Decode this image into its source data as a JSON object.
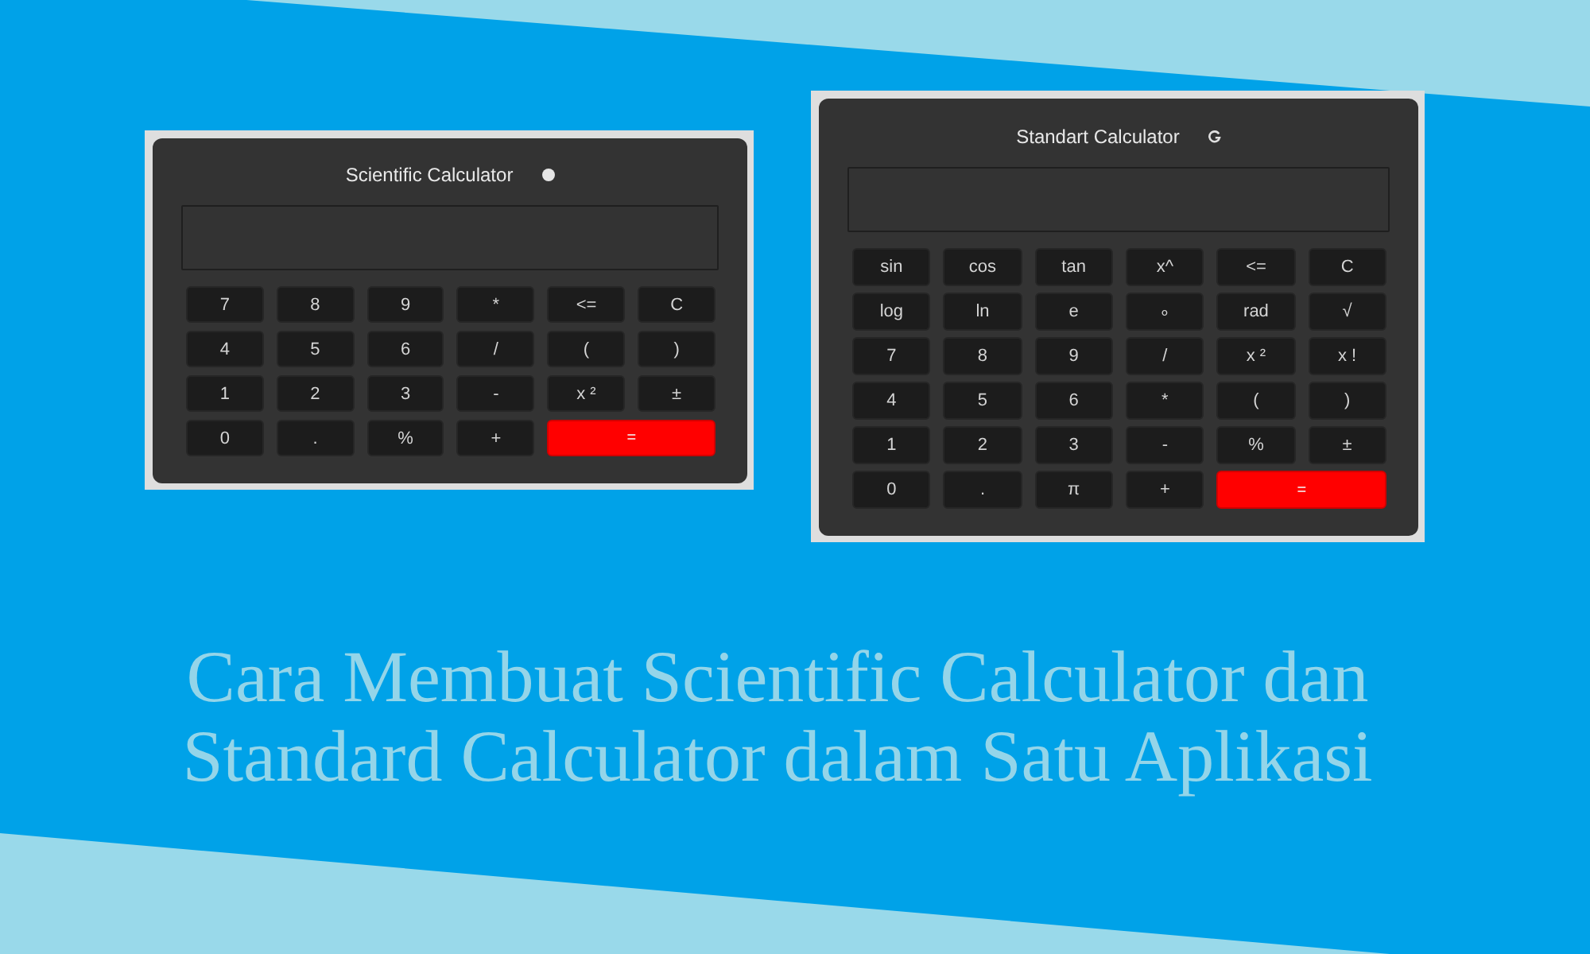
{
  "calculators": [
    {
      "title": "Scientific Calculator",
      "keys": [
        {
          "label": "7",
          "kind": "key"
        },
        {
          "label": "8",
          "kind": "key"
        },
        {
          "label": "9",
          "kind": "key"
        },
        {
          "label": "*",
          "kind": "key"
        },
        {
          "label": "<=",
          "kind": "key"
        },
        {
          "label": "C",
          "kind": "key"
        },
        {
          "label": "4",
          "kind": "key"
        },
        {
          "label": "5",
          "kind": "key"
        },
        {
          "label": "6",
          "kind": "key"
        },
        {
          "label": "/",
          "kind": "key"
        },
        {
          "label": "(",
          "kind": "key"
        },
        {
          "label": ")",
          "kind": "key"
        },
        {
          "label": "1",
          "kind": "key"
        },
        {
          "label": "2",
          "kind": "key"
        },
        {
          "label": "3",
          "kind": "key"
        },
        {
          "label": "-",
          "kind": "key"
        },
        {
          "label": "x ²",
          "kind": "key"
        },
        {
          "label": "±",
          "kind": "key"
        },
        {
          "label": "0",
          "kind": "key"
        },
        {
          "label": ".",
          "kind": "key"
        },
        {
          "label": "%",
          "kind": "key"
        },
        {
          "label": "+",
          "kind": "key"
        },
        {
          "label": "=",
          "kind": "equals"
        }
      ]
    },
    {
      "title": "Standart Calculator",
      "keys": [
        {
          "label": "sin",
          "kind": "key"
        },
        {
          "label": "cos",
          "kind": "key"
        },
        {
          "label": "tan",
          "kind": "key"
        },
        {
          "label": "x^",
          "kind": "key"
        },
        {
          "label": "<=",
          "kind": "key"
        },
        {
          "label": "C",
          "kind": "key"
        },
        {
          "label": "log",
          "kind": "key"
        },
        {
          "label": "ln",
          "kind": "key"
        },
        {
          "label": "e",
          "kind": "key"
        },
        {
          "label": "∘",
          "kind": "key"
        },
        {
          "label": "rad",
          "kind": "key"
        },
        {
          "label": "√",
          "kind": "key"
        },
        {
          "label": "7",
          "kind": "key"
        },
        {
          "label": "8",
          "kind": "key"
        },
        {
          "label": "9",
          "kind": "key"
        },
        {
          "label": "/",
          "kind": "key"
        },
        {
          "label": "x ²",
          "kind": "key"
        },
        {
          "label": "x !",
          "kind": "key"
        },
        {
          "label": "4",
          "kind": "key"
        },
        {
          "label": "5",
          "kind": "key"
        },
        {
          "label": "6",
          "kind": "key"
        },
        {
          "label": "*",
          "kind": "key"
        },
        {
          "label": "(",
          "kind": "key"
        },
        {
          "label": ")",
          "kind": "key"
        },
        {
          "label": "1",
          "kind": "key"
        },
        {
          "label": "2",
          "kind": "key"
        },
        {
          "label": "3",
          "kind": "key"
        },
        {
          "label": "-",
          "kind": "key"
        },
        {
          "label": "%",
          "kind": "key"
        },
        {
          "label": "±",
          "kind": "key"
        },
        {
          "label": "0",
          "kind": "key"
        },
        {
          "label": ".",
          "kind": "key"
        },
        {
          "label": "π",
          "kind": "key"
        },
        {
          "label": "+",
          "kind": "key"
        },
        {
          "label": "=",
          "kind": "equals"
        }
      ]
    }
  ],
  "headline": {
    "lines": [
      "Cara Membuat Scientific Calculator dan",
      "Standard Calculator dalam Satu Aplikasi"
    ]
  }
}
